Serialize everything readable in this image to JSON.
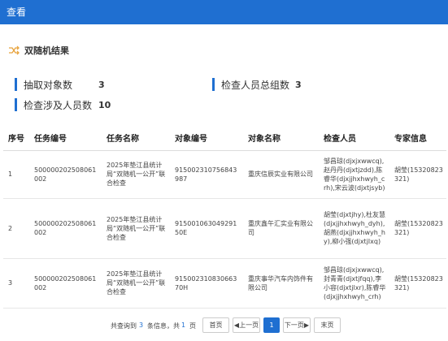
{
  "window": {
    "title": "查看"
  },
  "section": {
    "title": "双随机结果",
    "icon": "shuffle-icon"
  },
  "stats": [
    {
      "label": "抽取对象数",
      "value": "3"
    },
    {
      "label": "检查人员总组数",
      "value": "3"
    },
    {
      "label": "检查涉及人员数",
      "value": "10"
    }
  ],
  "table": {
    "headers": [
      "序号",
      "任务编号",
      "任务名称",
      "对象编号",
      "对象名称",
      "检查人员",
      "专家信息"
    ],
    "rows": [
      [
        "1",
        "500000202508061002",
        "2025年垫江县统计局“双随机一公开”联合检查",
        "915002310756843987",
        "重庆信辰实业有限公司",
        "邹昌琼(djxjxwwcq),赵丹丹(djxtjzdd),陈睿华(djxjjhxhwyh_crh),宋云波(djxtjsyb)",
        "胡莹(15320823321)"
      ],
      [
        "2",
        "500000202508061002",
        "2025年垫江县统计局“双随机一公开”联合检查",
        "91500106304929150E",
        "重庆鑫午汇实业有限公司",
        "胡莹(djxtjhy),杜友慧(djxjjhxhwyh_dyh),胡燕(djxjjhxhwyh_hy),柳小强(djxtjlxq)",
        "胡莹(15320823321)"
      ],
      [
        "3",
        "500000202508061002",
        "2025年垫江县统计局“双随机一公开”联合检查",
        "91500231083066370H",
        "重庆事华汽车内饰件有限公司",
        "邹昌琼(djxjxwwcq),封青青(djxtjfqq),李小容(djxtjlxr),陈睿华(djxjjhxhwyh_crh)",
        "胡莹(15320823321)"
      ]
    ]
  },
  "pagination": {
    "prefix": "共查询到",
    "total": "3",
    "middle": "条信息，共",
    "pages": "1",
    "suffix": "页",
    "first_label": "首页",
    "prev_label": "◀上一页",
    "current_page": "1",
    "next_label": "下一页▶",
    "last_label": "末页"
  },
  "colors": {
    "brand": "#1f6fd1",
    "accent_icon": "#e8a33d"
  }
}
